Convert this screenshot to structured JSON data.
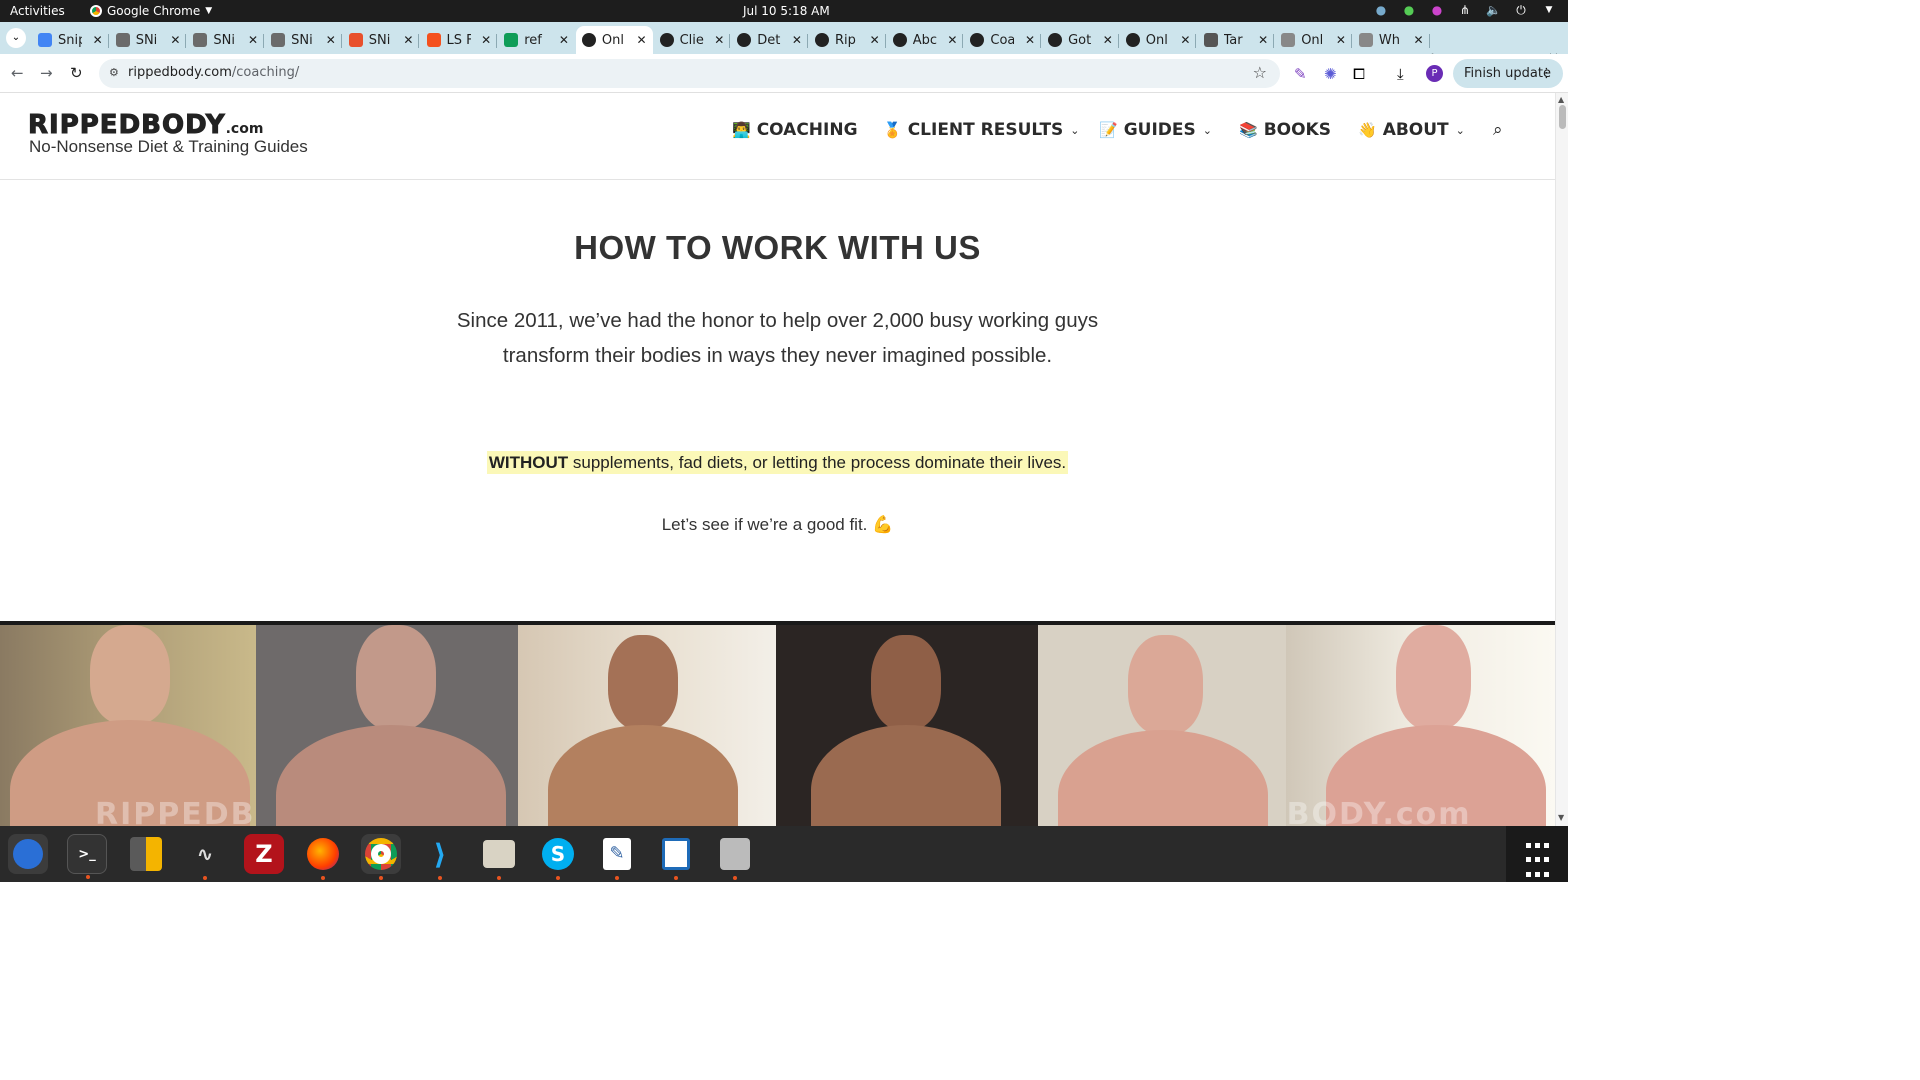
{
  "system_bar": {
    "activities": "Activities",
    "app_name": "Google Chrome",
    "clock": "Jul 10  5:18 AM"
  },
  "browser": {
    "tabs": [
      {
        "title": "Snip",
        "color": "#4285f4"
      },
      {
        "title": "SNi",
        "color": "#6b6b6b"
      },
      {
        "title": "SNi",
        "color": "#6b6b6b"
      },
      {
        "title": "SNi",
        "color": "#6b6b6b"
      },
      {
        "title": "SNi",
        "color": "#e8502c"
      },
      {
        "title": "LS F",
        "color": "#f4511e"
      },
      {
        "title": "ref",
        "color": "#0f9d58"
      },
      {
        "title": "Onl",
        "color": "#222222"
      },
      {
        "title": "Clie",
        "color": "#222222"
      },
      {
        "title": "Det",
        "color": "#222222"
      },
      {
        "title": "Rip",
        "color": "#222222"
      },
      {
        "title": "Abc",
        "color": "#222222"
      },
      {
        "title": "Coa",
        "color": "#222222"
      },
      {
        "title": "Got",
        "color": "#222222"
      },
      {
        "title": "Onl",
        "color": "#222222"
      },
      {
        "title": "Tar",
        "color": "#555555"
      },
      {
        "title": "Onl",
        "color": "#888888"
      },
      {
        "title": "Wh",
        "color": "#888888"
      }
    ],
    "active_tab_index": 7,
    "url_domain": "rippedbody.com",
    "url_path": "/coaching/",
    "finish_update": "Finish update",
    "profile_initial": "P"
  },
  "site": {
    "logo_main": "RIPPEDBODY",
    "logo_com": ".com",
    "tagline": "No-Nonsense Diet & Training Guides",
    "nav": [
      {
        "label": "COACHING",
        "emoji": "👨‍💻",
        "dropdown": false
      },
      {
        "label": "CLIENT RESULTS",
        "emoji": "🏅",
        "dropdown": true
      },
      {
        "label": "GUIDES",
        "emoji": "📝",
        "dropdown": true
      },
      {
        "label": "BOOKS",
        "emoji": "📚",
        "dropdown": false
      },
      {
        "label": "ABOUT",
        "emoji": "👋",
        "dropdown": true
      }
    ]
  },
  "content": {
    "heading": "HOW TO WORK WITH US",
    "intro": "Since 2011, we’ve had the honor to help over 2,000 busy working guys transform their bodies in ways they never imagined possible.",
    "without_bold": "WITHOUT",
    "without_rest": " supplements, fad diets, or letting the process dominate their lives.",
    "good_fit": "Let’s see if we’re a good fit. 💪",
    "watermark": "RIPPEDBODY.com"
  },
  "dock": [
    "Thunderbird",
    "Terminal",
    "Calculator",
    "System Monitor",
    "FileZilla",
    "Firefox",
    "Chrome",
    "VS Code",
    "Files",
    "Skype",
    "Text Editor",
    "LibreOffice Writer",
    "Disks"
  ]
}
